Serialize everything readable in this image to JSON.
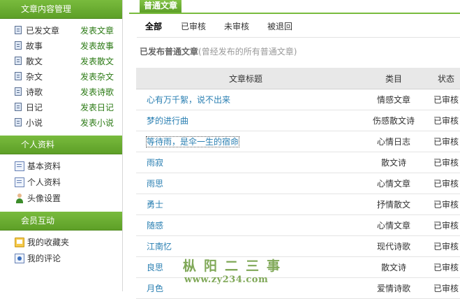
{
  "sidebar": {
    "content_section": {
      "title": "文章内容管理",
      "items": [
        {
          "label": "已发文章",
          "action": "发表文章"
        },
        {
          "label": "故事",
          "action": "发表故事"
        },
        {
          "label": "散文",
          "action": "发表散文"
        },
        {
          "label": "杂文",
          "action": "发表杂文"
        },
        {
          "label": "诗歌",
          "action": "发表诗歌"
        },
        {
          "label": "日记",
          "action": "发表日记"
        },
        {
          "label": "小说",
          "action": "发表小说"
        }
      ]
    },
    "profile_section": {
      "title": "个人资料",
      "items": [
        {
          "label": "基本资料",
          "icon": "profile-card-icon"
        },
        {
          "label": "个人资料",
          "icon": "profile-card-icon"
        },
        {
          "label": "头像设置",
          "icon": "user-avatar-icon"
        }
      ]
    },
    "interact_section": {
      "title": "会员互动",
      "items": [
        {
          "label": "我的收藏夹",
          "icon": "favorites-folder-icon"
        },
        {
          "label": "我的评论",
          "icon": "comment-icon"
        }
      ]
    }
  },
  "main": {
    "tab_label": "普通文章",
    "filters": [
      {
        "label": "全部",
        "active": true
      },
      {
        "label": "已审核",
        "active": false
      },
      {
        "label": "未审核",
        "active": false
      },
      {
        "label": "被退回",
        "active": false
      }
    ],
    "section_title": "已发布普通文章",
    "section_note": "(曾经发布的所有普通文章)",
    "table": {
      "headers": [
        "文章标题",
        "类目",
        "状态"
      ],
      "rows": [
        {
          "title": "心有万千絮，说不出来",
          "category": "情感文章",
          "status": "已审核"
        },
        {
          "title": "梦的进行曲",
          "category": "伤感散文诗",
          "status": "已审核"
        },
        {
          "title": "等待雨，是伞一生的宿命",
          "category": "心情日志",
          "status": "已审核"
        },
        {
          "title": "雨寂",
          "category": "散文诗",
          "status": "已审核"
        },
        {
          "title": "雨思",
          "category": "心情文章",
          "status": "已审核"
        },
        {
          "title": "勇士",
          "category": "抒情散文",
          "status": "已审核"
        },
        {
          "title": "随感",
          "category": "心情文章",
          "status": "已审核"
        },
        {
          "title": "江南忆",
          "category": "现代诗歌",
          "status": "已审核"
        },
        {
          "title": "良思",
          "category": "散文诗",
          "status": "已审核"
        },
        {
          "title": "月色",
          "category": "爱情诗歌",
          "status": "已审核"
        }
      ]
    }
  },
  "watermark": {
    "name": "枞阳二三事",
    "url": "www.zy234.com"
  },
  "colors": {
    "accent_green": "#6aab30",
    "link_blue": "#2a7fb2",
    "action_green": "#2b7a14"
  }
}
